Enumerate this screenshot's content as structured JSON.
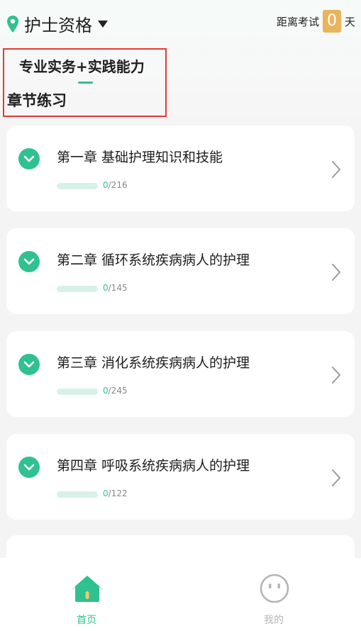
{
  "header": {
    "location_title": "护士资格",
    "countdown_label": "距离考试",
    "countdown_value": "0",
    "countdown_unit": "天"
  },
  "subject_tab": "专业实务+实践能力",
  "section_title": "章节练习",
  "chapters": [
    {
      "title": "第一章 基础护理知识和技能",
      "done": "0",
      "total": "/216"
    },
    {
      "title": "第二章 循环系统疾病病人的护理",
      "done": "0",
      "total": "/145"
    },
    {
      "title": "第三章 消化系统疾病病人的护理",
      "done": "0",
      "total": "/245"
    },
    {
      "title": "第四章 呼吸系统疾病病人的护理",
      "done": "0",
      "total": "/122"
    }
  ],
  "nav": {
    "home_label": "首页",
    "me_label": "我的"
  },
  "colors": {
    "accent": "#30c190",
    "countdown_badge": "#e9b45c",
    "highlight_box": "#e53935"
  },
  "icons": {
    "location": "map-pin-icon",
    "check": "check-circle-icon",
    "chevron": "chevron-right-icon",
    "home": "home-icon",
    "me": "face-icon"
  }
}
